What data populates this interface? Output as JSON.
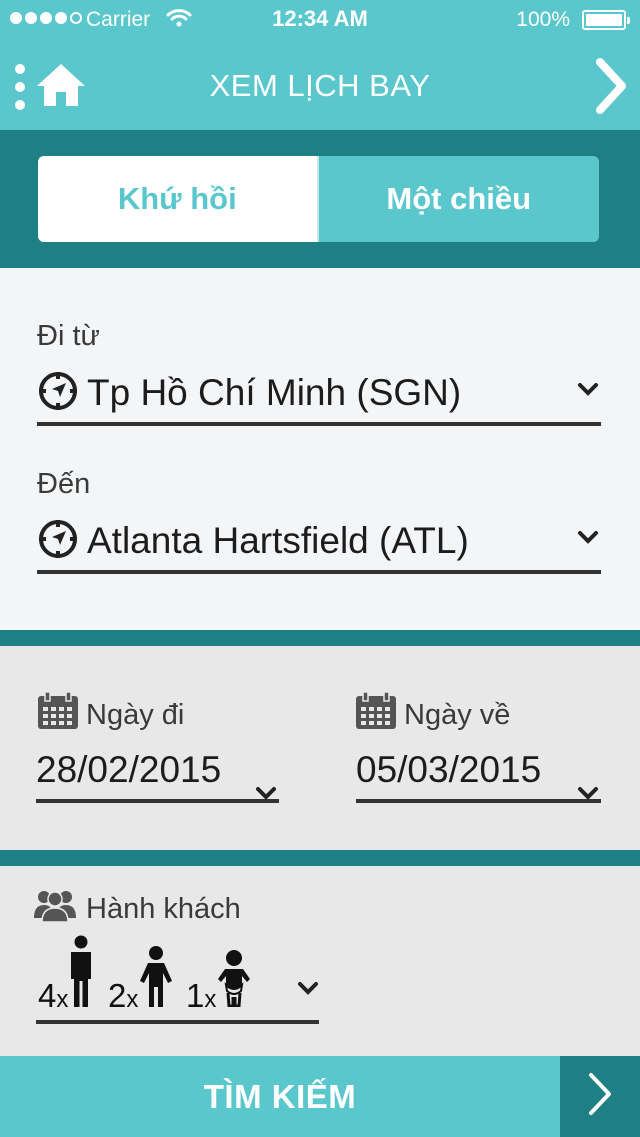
{
  "status_bar": {
    "carrier": "Carrier",
    "time": "12:34 AM",
    "battery": "100%",
    "signal_bars_filled": 4,
    "signal_bars_total": 5
  },
  "nav": {
    "title": "XEM LỊCH BAY",
    "left_icons": [
      "menu-dots-icon",
      "home-icon"
    ],
    "right_icon": "chevron-right-icon"
  },
  "trip_type": {
    "options": [
      "Khứ hồi",
      "Một chiều"
    ],
    "selected": "Khứ hồi"
  },
  "route": {
    "from_label": "Đi từ",
    "from_value": "Tp Hồ Chí Minh (SGN)",
    "to_label": "Đến",
    "to_value": "Atlanta Hartsfield (ATL)",
    "field_icon": "compass-icon"
  },
  "dates": {
    "depart_label": "Ngày đi",
    "depart_value": "28/02/2015",
    "return_label": "Ngày về",
    "return_value": "05/03/2015",
    "field_icon": "calendar-icon"
  },
  "passengers": {
    "label": "Hành khách",
    "icon": "people-icon",
    "adults": "4",
    "children": "2",
    "infants": "1",
    "multiplier": "x"
  },
  "search": {
    "label": "TÌM KIẾM",
    "icon": "chevron-right-icon"
  },
  "colors": {
    "accent": "#5ac7cd",
    "dark_teal": "#1e8084",
    "light_bg": "#f4f5f7",
    "panel_bg": "#e8e8e9"
  }
}
